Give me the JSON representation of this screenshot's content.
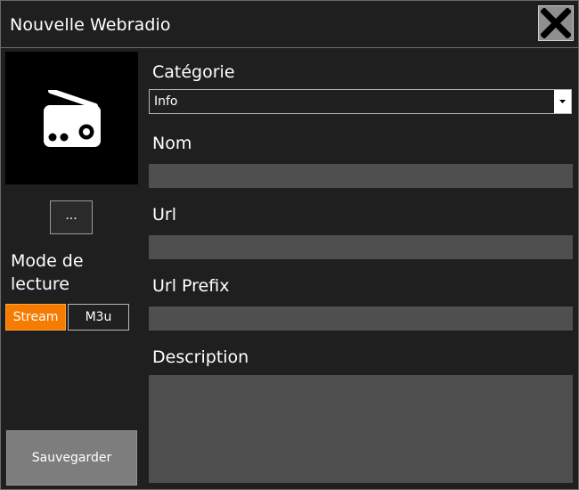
{
  "window": {
    "title": "Nouvelle Webradio"
  },
  "icons": {
    "close": "close-x-icon",
    "radio": "radio-icon",
    "dropdown": "chevron-down-icon"
  },
  "sidebar": {
    "browse_label": "...",
    "mode_label": "Mode de lecture",
    "modes": [
      {
        "label": "Stream",
        "selected": true
      },
      {
        "label": "M3u",
        "selected": false
      }
    ],
    "save_label": "Sauvegarder"
  },
  "form": {
    "categorie": {
      "label": "Catégorie",
      "value": "Info"
    },
    "nom": {
      "label": "Nom",
      "value": ""
    },
    "url": {
      "label": "Url",
      "value": ""
    },
    "url_prefix": {
      "label": "Url Prefix",
      "value": ""
    },
    "description": {
      "label": "Description",
      "value": ""
    }
  },
  "colors": {
    "accent": "#f57c00",
    "background": "#1f1f1f",
    "input": "#4f4f4f",
    "button": "#7d7d7d"
  }
}
